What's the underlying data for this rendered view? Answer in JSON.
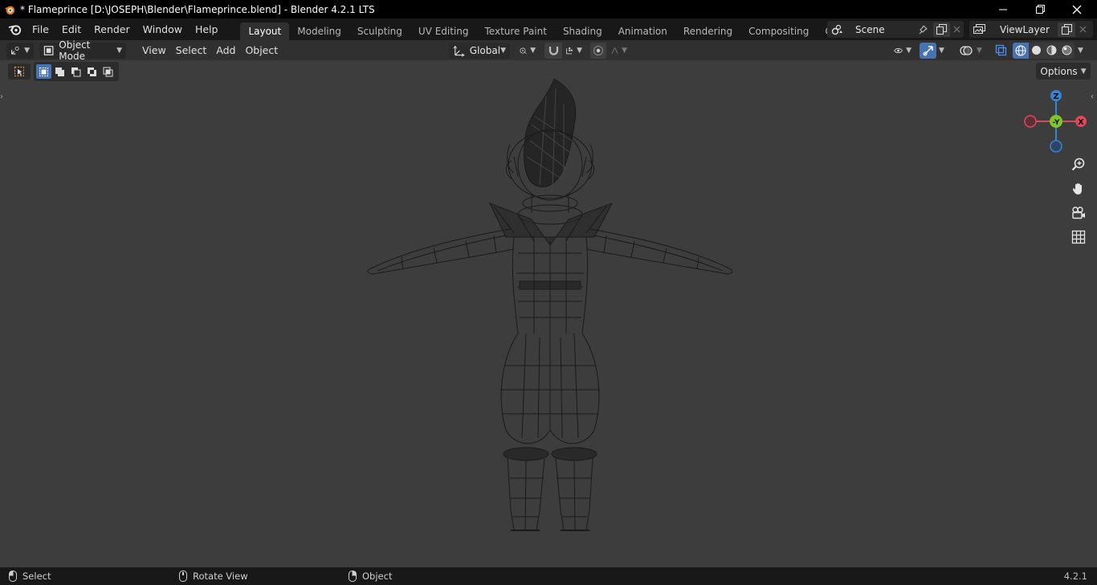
{
  "window": {
    "title": "* Flameprince [D:\\JOSEPH\\Blender\\Flameprince.blend] - Blender 4.2.1 LTS",
    "controls": [
      "minimize-icon",
      "restore-icon",
      "close-icon"
    ]
  },
  "menus": [
    "File",
    "Edit",
    "Render",
    "Window",
    "Help"
  ],
  "workspaces": [
    {
      "label": "Layout",
      "active": true
    },
    {
      "label": "Modeling"
    },
    {
      "label": "Sculpting"
    },
    {
      "label": "UV Editing"
    },
    {
      "label": "Texture Paint"
    },
    {
      "label": "Shading"
    },
    {
      "label": "Animation"
    },
    {
      "label": "Rendering"
    },
    {
      "label": "Compositing"
    },
    {
      "label": "Geometry Node"
    }
  ],
  "scene": {
    "label": "Scene"
  },
  "view_layer": {
    "label": "ViewLayer"
  },
  "header": {
    "mode": "Object Mode",
    "menus": [
      "View",
      "Select",
      "Add",
      "Object"
    ],
    "orientation": "Global"
  },
  "viewport": {
    "options_label": "Options",
    "gizmo": {
      "z": "Z",
      "y": "-Y",
      "x": "X"
    },
    "colors": {
      "x": "#e0475a",
      "y": "#82c624",
      "z": "#3a82d3",
      "active": "#4772b3"
    }
  },
  "status": {
    "select": "Select",
    "rotate": "Rotate View",
    "object": "Object",
    "version": "4.2.1"
  }
}
